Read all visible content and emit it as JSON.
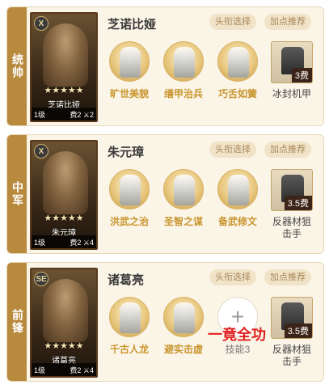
{
  "cards": [
    {
      "role": "统帅",
      "name": "芝诺比娅",
      "portrait_name": "芝诺比娅",
      "rank_badge": "X",
      "stars": "★★★★★",
      "level": "1级",
      "cost_text": "费2",
      "stat_text": "2",
      "title_button": "头衔选择",
      "rec_button": "加点推荐",
      "skills": [
        "旷世美貌",
        "缮甲治兵",
        "巧舌如簧"
      ],
      "gear": {
        "cost": "3费",
        "label": "冰封机甲"
      }
    },
    {
      "role": "中军",
      "name": "朱元璋",
      "portrait_name": "朱元璋",
      "rank_badge": "X",
      "stars": "★★★★★",
      "level": "1级",
      "cost_text": "费2",
      "stat_text": "4",
      "title_button": "头衔选择",
      "rec_button": "加点推荐",
      "skills": [
        "洪武之治",
        "圣智之谋",
        "备武修文"
      ],
      "gear": {
        "cost": "3.5费",
        "label": "反器材狙击手"
      }
    },
    {
      "role": "前锋",
      "name": "诸葛亮",
      "portrait_name": "诸葛亮",
      "rank_badge": "SE",
      "stars": "★★★★★",
      "level": "1级",
      "cost_text": "费2",
      "stat_text": "4",
      "title_button": "头衔选择",
      "rec_button": "加点推荐",
      "skills": [
        "千古人龙",
        "避实击虚"
      ],
      "empty_skill": {
        "plus": "+",
        "label": "技能3"
      },
      "gear": {
        "cost": "3.5费",
        "label": "反器材狙击手"
      }
    }
  ],
  "overlay_text": "一竟全功",
  "colors": {
    "role_tab": "#b88a3e",
    "card_bg": "#fbf5e8",
    "skill_label": "#c9962f",
    "overlay": "#e02020"
  }
}
